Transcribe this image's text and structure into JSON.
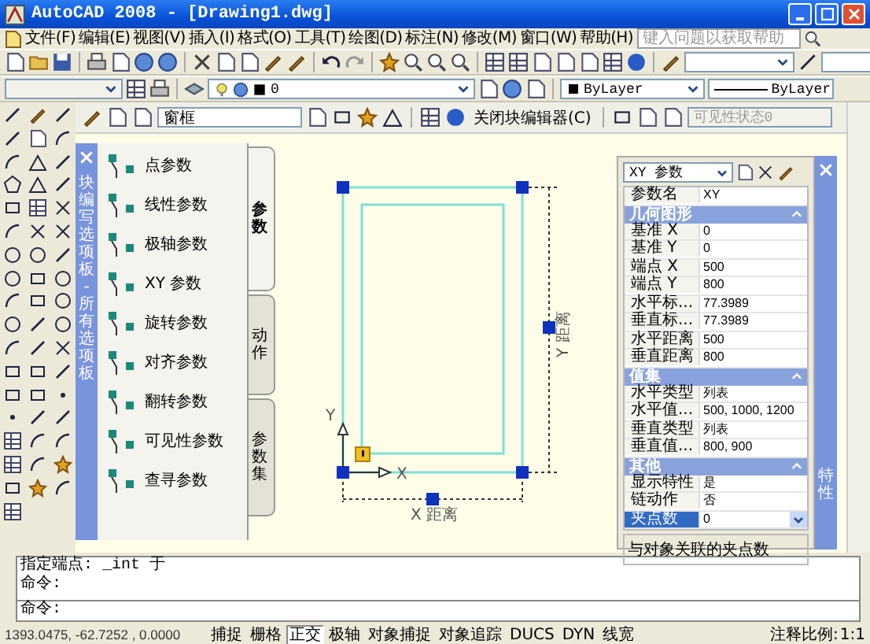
{
  "window": {
    "title": "AutoCAD 2008 - [Drawing1.dwg]"
  },
  "menu": [
    "文件(F)",
    "编辑(E)",
    "视图(V)",
    "插入(I)",
    "格式(O)",
    "工具(T)",
    "绘图(D)",
    "标注(N)",
    "修改(M)",
    "窗口(W)",
    "帮助(H)"
  ],
  "help_search": {
    "placeholder": "键入问题以获取帮助"
  },
  "layer_combo": {
    "value": "0"
  },
  "color_combo": {
    "value": "ByLayer"
  },
  "linetype_combo": {
    "value": "ByLayer"
  },
  "block_editor_toolbar": {
    "block_name": "窗框",
    "close_button": "关闭块编辑器(C)",
    "visibility_state": {
      "value": "可见性状态0",
      "disabled": true
    }
  },
  "palette": {
    "title": "块编写选项板 - 所有选项板",
    "items": [
      "点参数",
      "线性参数",
      "极轴参数",
      "XY 参数",
      "旋转参数",
      "对齐参数",
      "翻转参数",
      "可见性参数",
      "查寻参数"
    ],
    "tabs": [
      {
        "label": "参数",
        "selected": true
      },
      {
        "label": "动作",
        "selected": false
      },
      {
        "label": "参数集",
        "selected": false
      }
    ]
  },
  "drawing": {
    "x_axis": "X",
    "y_axis": "Y",
    "x_dimension": "X 距离",
    "y_dimension": "Y 距离"
  },
  "properties": {
    "title": "特性",
    "type_combo": "XY 参数",
    "name_row": {
      "label": "参数名",
      "value": "XY",
      "selected": false
    },
    "sections": [
      {
        "title": "几何图形",
        "expanded": true,
        "rows": [
          {
            "label": "基准 X",
            "value": "0",
            "selected": false
          },
          {
            "label": "基准 Y",
            "value": "0",
            "selected": false
          },
          {
            "label": "端点 X",
            "value": "500",
            "selected": false
          },
          {
            "label": "端点 Y",
            "value": "800",
            "selected": false
          },
          {
            "label": "水平标...",
            "value": "77.3989",
            "selected": false
          },
          {
            "label": "垂直标...",
            "value": "77.3989",
            "selected": false
          },
          {
            "label": "水平距离",
            "value": "500",
            "selected": false
          },
          {
            "label": "垂直距离",
            "value": "800",
            "selected": false
          }
        ]
      },
      {
        "title": "值集",
        "expanded": true,
        "rows": [
          {
            "label": "水平类型",
            "value": "列表",
            "selected": false
          },
          {
            "label": "水平值...",
            "value": "500, 1000, 1200",
            "selected": false
          },
          {
            "label": "垂直类型",
            "value": "列表",
            "selected": false
          },
          {
            "label": "垂直值...",
            "value": "800, 900",
            "selected": false
          }
        ]
      },
      {
        "title": "其他",
        "expanded": true,
        "rows": [
          {
            "label": "显示特性",
            "value": "是",
            "selected": false
          },
          {
            "label": "链动作",
            "value": "否",
            "selected": false
          },
          {
            "label": "夹点数",
            "value": "0",
            "selected": true
          }
        ]
      }
    ],
    "description": "与对象关联的夹点数"
  },
  "command": {
    "history": [
      "指定端点: _int 于",
      "命令:"
    ],
    "prompt": "命令:"
  },
  "status_bar": {
    "coordinates": "1393.0475, -62.7252 , 0.0000",
    "toggles": [
      {
        "label": "捕捉",
        "on": false
      },
      {
        "label": "栅格",
        "on": false
      },
      {
        "label": "正交",
        "on": true
      },
      {
        "label": "极轴",
        "on": false
      },
      {
        "label": "对象捕捉",
        "on": false
      },
      {
        "label": "对象追踪",
        "on": false
      },
      {
        "label": "DUCS",
        "on": false
      },
      {
        "label": "DYN",
        "on": false
      },
      {
        "label": "线宽",
        "on": false
      }
    ],
    "annotation_scale_label": "注释比例:",
    "annotation_scale": "1:1"
  }
}
